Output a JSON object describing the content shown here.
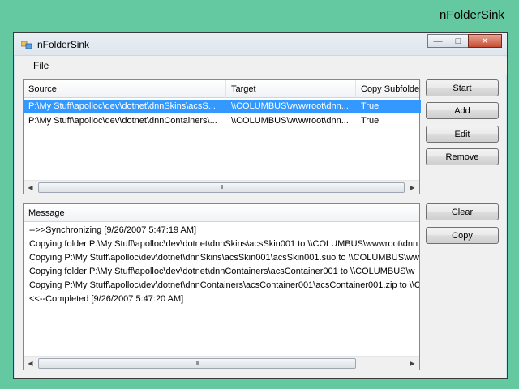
{
  "desktop_caption": "nFolderSink",
  "window": {
    "title": "nFolderSink",
    "minimize_glyph": "—",
    "maximize_glyph": "□",
    "close_glyph": "✕"
  },
  "menu": {
    "file": "File"
  },
  "grid": {
    "columns": [
      "Source",
      "Target",
      "Copy Subfolders"
    ],
    "rows": [
      {
        "source": "P:\\My Stuff\\apolloc\\dev\\dotnet\\dnnSkins\\acsS...",
        "target": "\\\\COLUMBUS\\wwwroot\\dnn...",
        "copy": "True",
        "selected": true
      },
      {
        "source": "P:\\My Stuff\\apolloc\\dev\\dotnet\\dnnContainers\\...",
        "target": "\\\\COLUMBUS\\wwwroot\\dnn...",
        "copy": "True",
        "selected": false
      }
    ]
  },
  "messages": {
    "header": "Message",
    "lines": [
      "-->>Synchronizing [9/26/2007 5:47:19 AM]",
      "Copying folder P:\\My Stuff\\apolloc\\dev\\dotnet\\dnnSkins\\acsSkin001 to \\\\COLUMBUS\\wwwroot\\dnn",
      "Copying P:\\My Stuff\\apolloc\\dev\\dotnet\\dnnSkins\\acsSkin001\\acsSkin001.suo to \\\\COLUMBUS\\ww",
      "Copying folder P:\\My Stuff\\apolloc\\dev\\dotnet\\dnnContainers\\acsContainer001 to \\\\COLUMBUS\\w",
      "Copying P:\\My Stuff\\apolloc\\dev\\dotnet\\dnnContainers\\acsContainer001\\acsContainer001.zip to \\\\C",
      "<<--Completed [9/26/2007 5:47:20 AM]"
    ]
  },
  "buttons": {
    "start": "Start",
    "add": "Add",
    "edit": "Edit",
    "remove": "Remove",
    "clear": "Clear",
    "copy": "Copy"
  },
  "icons": {
    "scroll_left": "◀",
    "scroll_right": "▶",
    "thumb_grip": "III"
  },
  "colors": {
    "desktop": "#64c8a0",
    "selection": "#3399ff"
  }
}
